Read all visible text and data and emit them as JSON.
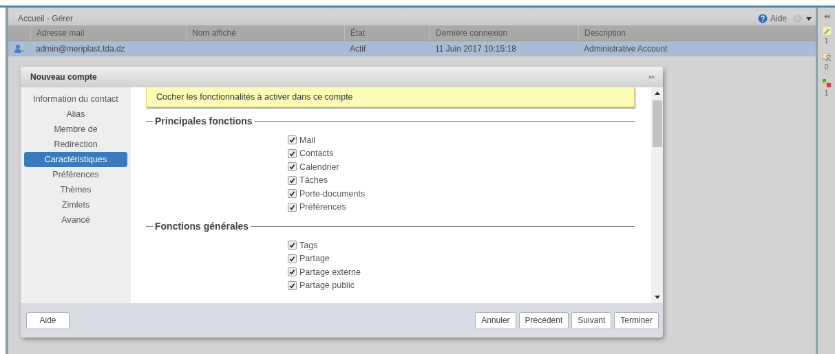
{
  "panel": {
    "title": "Accueil - Gérer",
    "help": "Aide"
  },
  "table": {
    "columns": [
      "Adresse mail",
      "Nom affiché",
      "État",
      "Dernière connexion",
      "Description"
    ],
    "rows": [
      {
        "selected": true,
        "cells": [
          "admin@meriplast.tda.dz",
          "",
          "Actif",
          "11 Juin 2017 10:15:18",
          "Administrative Account"
        ]
      }
    ]
  },
  "side_counts": [
    "1",
    "0",
    "1"
  ],
  "dialog": {
    "title": "Nouveau compte",
    "nav": [
      {
        "label": "Information du contact",
        "selected": false
      },
      {
        "label": "Alias",
        "selected": false
      },
      {
        "label": "Membre de",
        "selected": false
      },
      {
        "label": "Redirection",
        "selected": false
      },
      {
        "label": "Caractéristiques",
        "selected": true
      },
      {
        "label": "Préférences",
        "selected": false
      },
      {
        "label": "Thèmes",
        "selected": false
      },
      {
        "label": "Zimlets",
        "selected": false
      },
      {
        "label": "Avancé",
        "selected": false
      }
    ],
    "notice": "Cocher les fonctionnalités à activer dans ce compte",
    "sections": [
      {
        "title": "Principales fonctions",
        "items": [
          {
            "label": "Mail",
            "checked": true
          },
          {
            "label": "Contacts",
            "checked": true
          },
          {
            "label": "Calendrier",
            "checked": true
          },
          {
            "label": "Tâches",
            "checked": true
          },
          {
            "label": "Porte-documents",
            "checked": true
          },
          {
            "label": "Préférences",
            "checked": true
          }
        ]
      },
      {
        "title": "Fonctions générales",
        "items": [
          {
            "label": "Tags",
            "checked": true
          },
          {
            "label": "Partage",
            "checked": true
          },
          {
            "label": "Partage externe",
            "checked": true
          },
          {
            "label": "Partage public",
            "checked": true
          }
        ]
      }
    ],
    "left_buttons": [
      "Aide"
    ],
    "right_buttons": [
      "Annuler",
      "Précédent",
      "Suivant",
      "Terminer"
    ]
  }
}
